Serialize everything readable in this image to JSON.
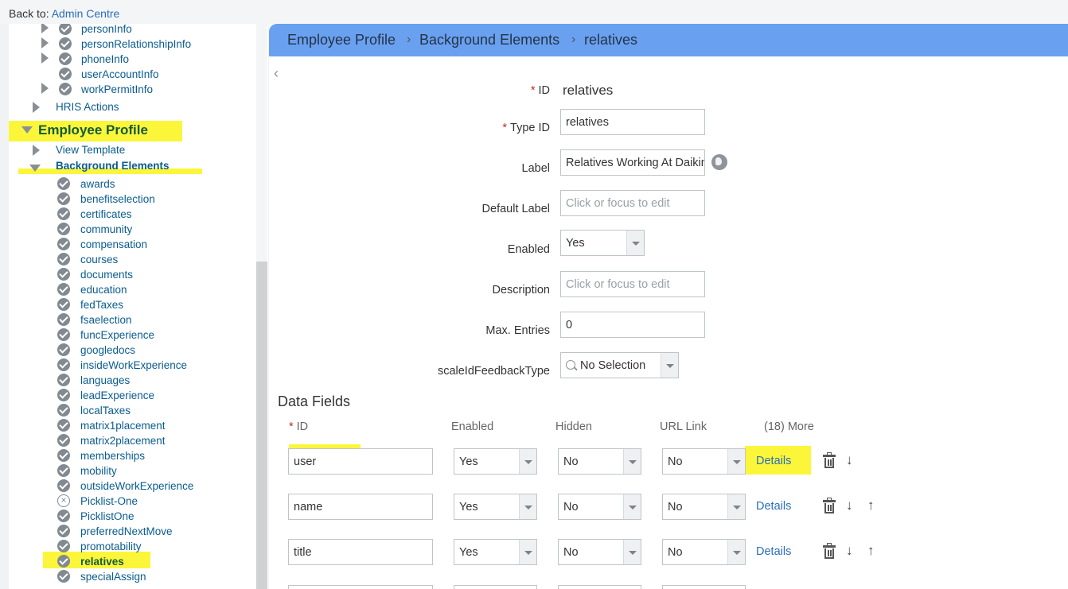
{
  "backbar": {
    "prefix": "Back to: ",
    "link": "Admin Centre"
  },
  "tree": {
    "top_items": [
      {
        "label": "personInfo",
        "expandable": true,
        "check": "ok"
      },
      {
        "label": "personRelationshipInfo",
        "expandable": true,
        "check": "ok"
      },
      {
        "label": "phoneInfo",
        "expandable": true,
        "check": "ok"
      },
      {
        "label": "userAccountInfo",
        "expandable": false,
        "check": "ok"
      },
      {
        "label": "workPermitInfo",
        "expandable": true,
        "check": "ok"
      }
    ],
    "hris_actions": "HRIS Actions",
    "employee_profile": "Employee Profile",
    "view_template": "View Template",
    "background_elements": "Background Elements",
    "background_items": [
      {
        "label": "awards",
        "check": "ok"
      },
      {
        "label": "benefitselection",
        "check": "ok"
      },
      {
        "label": "certificates",
        "check": "ok"
      },
      {
        "label": "community",
        "check": "ok"
      },
      {
        "label": "compensation",
        "check": "ok"
      },
      {
        "label": "courses",
        "check": "ok"
      },
      {
        "label": "documents",
        "check": "ok"
      },
      {
        "label": "education",
        "check": "ok"
      },
      {
        "label": "fedTaxes",
        "check": "ok"
      },
      {
        "label": "fsaelection",
        "check": "ok"
      },
      {
        "label": "funcExperience",
        "check": "ok"
      },
      {
        "label": "googledocs",
        "check": "ok"
      },
      {
        "label": "insideWorkExperience",
        "check": "ok"
      },
      {
        "label": "languages",
        "check": "ok"
      },
      {
        "label": "leadExperience",
        "check": "ok"
      },
      {
        "label": "localTaxes",
        "check": "ok"
      },
      {
        "label": "matrix1placement",
        "check": "ok"
      },
      {
        "label": "matrix2placement",
        "check": "ok"
      },
      {
        "label": "memberships",
        "check": "ok"
      },
      {
        "label": "mobility",
        "check": "ok"
      },
      {
        "label": "outsideWorkExperience",
        "check": "ok"
      },
      {
        "label": "Picklist-One",
        "check": "x"
      },
      {
        "label": "PicklistOne",
        "check": "ok"
      },
      {
        "label": "preferredNextMove",
        "check": "ok"
      },
      {
        "label": "promotability",
        "check": "ok"
      },
      {
        "label": "relatives",
        "check": "ok",
        "selected": true
      },
      {
        "label": "specialAssign",
        "check": "ok"
      }
    ]
  },
  "breadcrumb": [
    "Employee Profile",
    "Background Elements",
    "relatives"
  ],
  "form": {
    "id_label": "ID",
    "id_value": "relatives",
    "type_id_label": "Type ID",
    "type_id_value": "relatives",
    "label_label": "Label",
    "label_value": "Relatives Working At Daikin",
    "default_label_label": "Default Label",
    "default_label_placeholder": "Click or focus to edit",
    "enabled_label": "Enabled",
    "enabled_value": "Yes",
    "description_label": "Description",
    "description_placeholder": "Click or focus to edit",
    "max_entries_label": "Max. Entries",
    "max_entries_value": "0",
    "scale_label": "scaleIdFeedbackType",
    "scale_value": "No Selection"
  },
  "data_fields": {
    "title": "Data Fields",
    "columns": {
      "id": "ID",
      "enabled": "Enabled",
      "hidden": "Hidden",
      "url_link": "URL Link",
      "more": "(18) More"
    },
    "rows": [
      {
        "id": "user",
        "enabled": "Yes",
        "hidden": "No",
        "url_link": "No",
        "details": "Details",
        "up": false
      },
      {
        "id": "name",
        "enabled": "Yes",
        "hidden": "No",
        "url_link": "No",
        "details": "Details",
        "up": true
      },
      {
        "id": "title",
        "enabled": "Yes",
        "hidden": "No",
        "url_link": "No",
        "details": "Details",
        "up": true
      }
    ]
  },
  "colors": {
    "highlight": "#fbf63a",
    "breadcrumb_bg": "#6aa0f0",
    "link": "#2a6ebb",
    "tree_text": "#0a5c8f"
  }
}
